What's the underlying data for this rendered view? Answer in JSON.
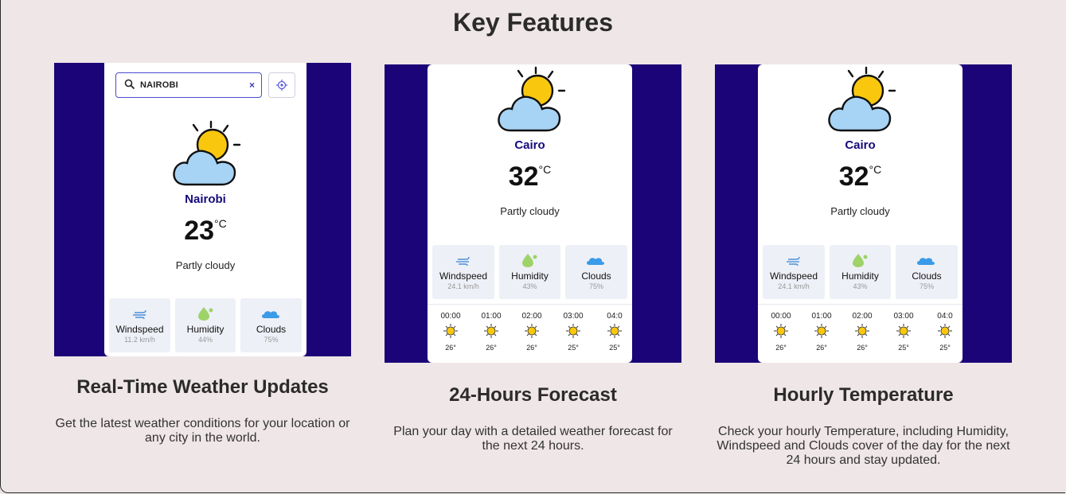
{
  "page": {
    "title": "Key Features"
  },
  "features": [
    {
      "title": "Real-Time Weather Updates",
      "description_lines": [
        "Get the latest weather conditions for your location or",
        "any city in the world."
      ],
      "screen": {
        "search_value": "NAIROBI",
        "clear_icon": "×",
        "city": "Nairobi",
        "temp": "23",
        "unit": "°C",
        "condition": "Partly cloudy",
        "stats": [
          {
            "label": "Windspeed",
            "value": "11.2 km/h",
            "icon": "wind-icon"
          },
          {
            "label": "Humidity",
            "value": "44%",
            "icon": "humidity-icon"
          },
          {
            "label": "Clouds",
            "value": "75%",
            "icon": "cloud-icon"
          }
        ]
      }
    },
    {
      "title": "24-Hours Forecast",
      "description_lines": [
        "Plan your day with a detailed weather forecast for",
        "the next 24 hours."
      ],
      "screen": {
        "city": "Cairo",
        "temp": "32",
        "unit": "°C",
        "condition": "Partly cloudy",
        "stats": [
          {
            "label": "Windspeed",
            "value": "24.1 km/h",
            "icon": "wind-icon"
          },
          {
            "label": "Humidity",
            "value": "43%",
            "icon": "humidity-icon"
          },
          {
            "label": "Clouds",
            "value": "75%",
            "icon": "cloud-icon"
          }
        ],
        "hours": [
          {
            "time": "00:00",
            "temp": "26°"
          },
          {
            "time": "01:00",
            "temp": "26°"
          },
          {
            "time": "02:00",
            "temp": "26°"
          },
          {
            "time": "03:00",
            "temp": "25°"
          },
          {
            "time": "04:0",
            "temp": "25°"
          }
        ]
      }
    },
    {
      "title": "Hourly Temperature",
      "description_lines": [
        "Check your hourly Temperature, including Humidity,",
        "Windspeed and Clouds cover of the day for the next",
        "24 hours and stay updated."
      ],
      "screen": {
        "city": "Cairo",
        "temp": "32",
        "unit": "°C",
        "condition": "Partly cloudy",
        "stats": [
          {
            "label": "Windspeed",
            "value": "24.1 km/h",
            "icon": "wind-icon"
          },
          {
            "label": "Humidity",
            "value": "43%",
            "icon": "humidity-icon"
          },
          {
            "label": "Clouds",
            "value": "75%",
            "icon": "cloud-icon"
          }
        ],
        "hours": [
          {
            "time": "00:00",
            "temp": "26°"
          },
          {
            "time": "01:00",
            "temp": "26°"
          },
          {
            "time": "02:00",
            "temp": "26°"
          },
          {
            "time": "03:00",
            "temp": "25°"
          },
          {
            "time": "04:0",
            "temp": "25°"
          }
        ]
      }
    }
  ],
  "colors": {
    "page_bg": "#efe6e7",
    "image_bg": "#1b0478",
    "city_text": "#140a7a",
    "stat_bg": "#eef0f7",
    "sun": "#f9c80e",
    "cloud": "#a7d3f5"
  }
}
